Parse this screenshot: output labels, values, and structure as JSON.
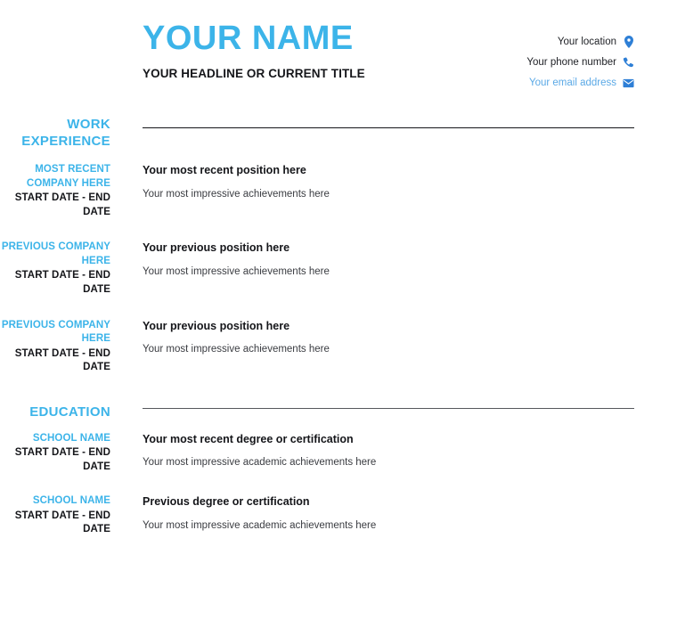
{
  "header": {
    "name": "YOUR NAME",
    "headline": "YOUR HEADLINE OR CURRENT TITLE",
    "contacts": [
      {
        "text": "Your location",
        "icon": "location-pin-icon",
        "is_link": false
      },
      {
        "text": "Your phone number",
        "icon": "phone-icon",
        "is_link": false
      },
      {
        "text": "Your email address",
        "icon": "envelope-icon",
        "is_link": true
      }
    ]
  },
  "colors": {
    "accent_blue": "#3cb4e9",
    "link_blue": "#5ba9e6",
    "icon_blue": "#2e7fd6",
    "text_dark": "#15161a",
    "text_body": "#3a3c41"
  },
  "work": {
    "heading": "WORK EXPERIENCE",
    "entries": [
      {
        "company": "MOST RECENT COMPANY HERE",
        "dates": "START DATE - END DATE",
        "title": "Your most recent position here",
        "description": "Your most impressive achievements here"
      },
      {
        "company": "PREVIOUS COMPANY HERE",
        "dates": "START DATE - END DATE",
        "title": "Your previous position here",
        "description": "Your most impressive achievements here"
      },
      {
        "company": "PREVIOUS COMPANY HERE",
        "dates": "START DATE - END DATE",
        "title": "Your previous position here",
        "description": "Your most impressive achievements here"
      }
    ]
  },
  "education": {
    "heading": "EDUCATION",
    "entries": [
      {
        "school": "SCHOOL NAME",
        "dates": "START DATE - END DATE",
        "degree": "Your most recent degree or certification",
        "description": "Your most impressive academic achievements here"
      },
      {
        "school": "SCHOOL NAME",
        "dates": "START DATE - END DATE",
        "degree": "Previous degree or certification",
        "description": "Your most impressive academic achievements here"
      }
    ]
  }
}
